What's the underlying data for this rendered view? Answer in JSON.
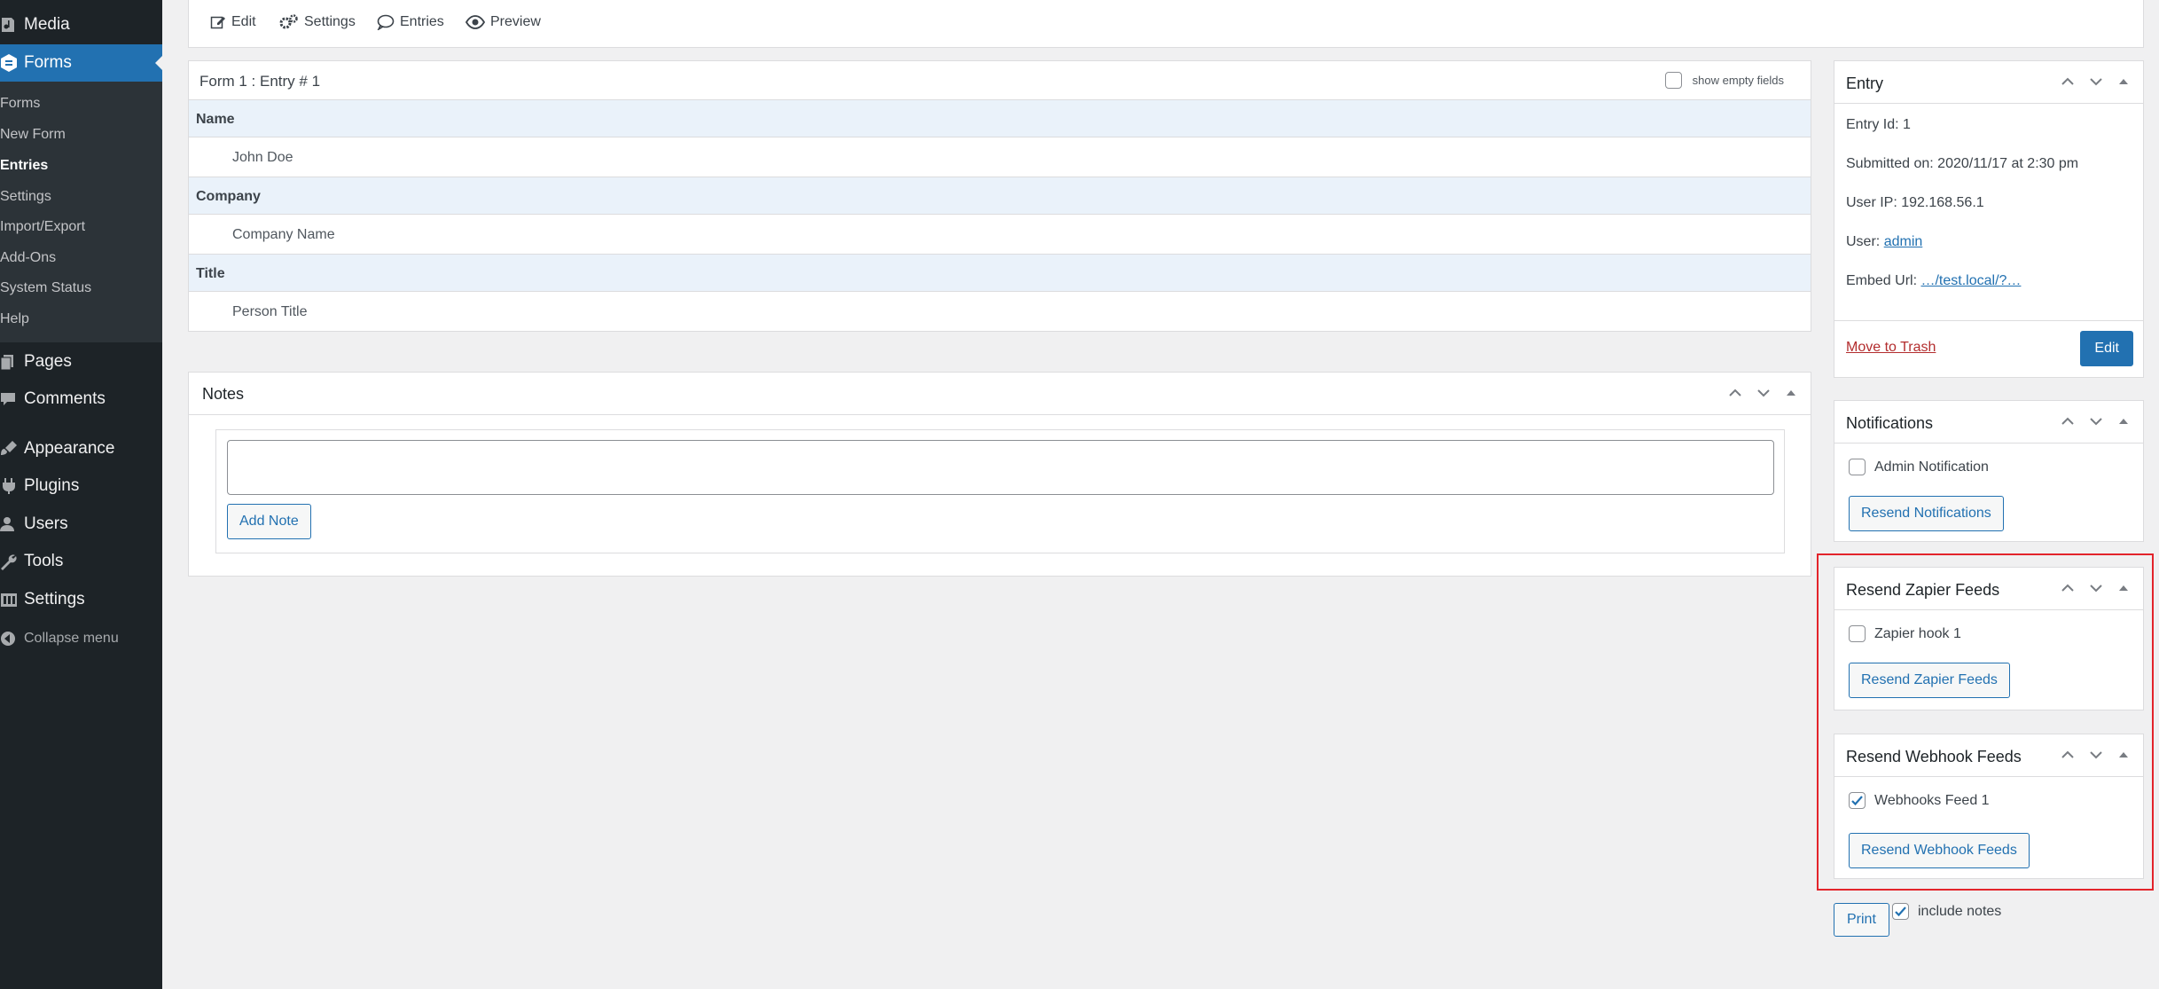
{
  "sidebar": {
    "media": "Media",
    "forms": "Forms",
    "submenu": [
      "Forms",
      "New Form",
      "Entries",
      "Settings",
      "Import/Export",
      "Add-Ons",
      "System Status",
      "Help"
    ],
    "pages": "Pages",
    "comments": "Comments",
    "appearance": "Appearance",
    "plugins": "Plugins",
    "users": "Users",
    "tools": "Tools",
    "settings": "Settings",
    "collapse": "Collapse menu"
  },
  "toolbar": {
    "edit": "Edit",
    "settings": "Settings",
    "entries": "Entries",
    "preview": "Preview"
  },
  "entry_detail": {
    "title": "Form 1 : Entry # 1",
    "show_empty_fields": "show empty fields",
    "fields": [
      {
        "label": "Name",
        "value": "John Doe"
      },
      {
        "label": "Company",
        "value": "Company Name"
      },
      {
        "label": "Title",
        "value": "Person Title"
      }
    ]
  },
  "notes": {
    "title": "Notes",
    "textarea_value": "",
    "add_note": "Add Note"
  },
  "entry_box": {
    "title": "Entry",
    "entry_id": "Entry Id: 1",
    "submitted_on": "Submitted on: 2020/11/17 at 2:30 pm",
    "user_ip": "User IP: 192.168.56.1",
    "user_label": "User:",
    "user_link": "admin",
    "embed_label": "Embed Url:",
    "embed_link": "…/test.local/?…",
    "move_to_trash": "Move to Trash",
    "edit": "Edit"
  },
  "notifications": {
    "title": "Notifications",
    "item": "Admin Notification",
    "item_checked": false,
    "button": "Resend Notifications"
  },
  "zapier": {
    "title": "Resend Zapier Feeds",
    "item": "Zapier hook 1",
    "item_checked": false,
    "button": "Resend Zapier Feeds"
  },
  "webhook": {
    "title": "Resend Webhook Feeds",
    "item": "Webhooks Feed 1",
    "item_checked": true,
    "button": "Resend Webhook Feeds"
  },
  "print": {
    "button": "Print",
    "include_notes": "include notes",
    "include_notes_checked": true
  },
  "colors": {
    "admin_bar": "#1d2327",
    "accent": "#2271b1",
    "highlight": "#e3242b",
    "field_label_bg": "#eaf2fa"
  }
}
